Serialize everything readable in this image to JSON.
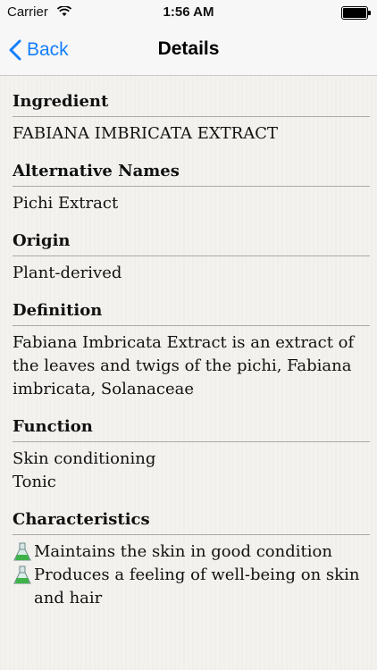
{
  "status_bar": {
    "carrier": "Carrier",
    "time": "1:56 AM",
    "wifi_icon": "wifi-icon",
    "battery_icon": "battery-icon"
  },
  "nav": {
    "back_label": "Back",
    "title": "Details",
    "accent_color": "#147efb"
  },
  "sections": {
    "ingredient": {
      "heading": "Ingredient",
      "value": "FABIANA IMBRICATA EXTRACT"
    },
    "alternative_names": {
      "heading": "Alternative Names",
      "value": "Pichi Extract"
    },
    "origin": {
      "heading": "Origin",
      "value": "Plant-derived"
    },
    "definition": {
      "heading": "Definition",
      "value": "Fabiana Imbricata Extract is an extract of the leaves and twigs of the pichi, Fabiana imbricata, Solanaceae"
    },
    "function": {
      "heading": "Function",
      "items": [
        "Skin conditioning",
        "Tonic"
      ]
    },
    "characteristics": {
      "heading": "Characteristics",
      "icon": "flask-icon",
      "items": [
        "Maintains the skin in good condition",
        "Produces a feeling of well-being on skin and hair"
      ]
    }
  }
}
